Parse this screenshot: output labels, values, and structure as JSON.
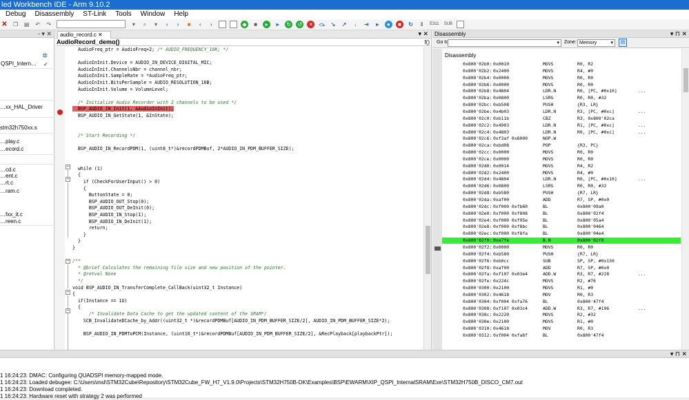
{
  "window": {
    "title": "led Workbench IDE - Arm 9.10.2"
  },
  "menu": [
    "Debug",
    "Disassembly",
    "ST-Link",
    "Tools",
    "Window",
    "Help"
  ],
  "toolbar": {
    "label_1": "E311",
    "label_2": "SUB"
  },
  "left_panel": {
    "controls": "- ▾ ✕",
    "items": [
      "QSPI_Intern…",
      "…xx_HAL_Driver",
      "stm32h750xx.s",
      "…play.c",
      "…ecord.c",
      "…cd.c",
      "…ent.c",
      "…rt.c",
      "…ram.c",
      "…fxx_it.c",
      "…reen.c"
    ]
  },
  "editor": {
    "tab_label": "audio_record.c",
    "function": "AudioRecord_demo()",
    "lines": [
      {
        "code": "  AudioFreq_ptr = AudioFreq+2; ",
        "comment": "/* AUDIO_FREQUENCY_16K; */"
      },
      {
        "code": ""
      },
      {
        "code": "  AudioInInit.Device = AUDIO_IN_DEVICE_DIGITAL_MIC;"
      },
      {
        "code": "  AudioInInit.ChannelsNbr = channel_nbr;"
      },
      {
        "code": "  AudioInInit.SampleRate = *AudioFreq_ptr;"
      },
      {
        "code": "  AudioInInit.BitsPerSample = AUDIO_RESOLUTION_16B;"
      },
      {
        "code": "  AudioInInit.Volume = VolumeLevel;"
      },
      {
        "code": ""
      },
      {
        "code": "  ",
        "comment": "/* Initialize Audio Recorder with 2 channels to be used */"
      },
      {
        "code": "",
        "highlight": "  BSP_AUDIO_IN_Init(1, &AudioInInit);"
      },
      {
        "code": "  BSP_AUDIO_IN_GetState(1, &InState);"
      },
      {
        "code": ""
      },
      {
        "code": ""
      },
      {
        "code": "  ",
        "comment": "/* Start Recording */"
      },
      {
        "code": ""
      },
      {
        "code": "  BSP_AUDIO_IN_RecordPDM(1, (uint8_t*)&recordPDMBuf, 2*AUDIO_IN_PDM_BUFFER_SIZE);"
      },
      {
        "code": ""
      },
      {
        "code": ""
      },
      {
        "code": "  while (1)"
      },
      {
        "code": "  {"
      },
      {
        "code": "    if (CheckForUserInput() > 0)"
      },
      {
        "code": "    {"
      },
      {
        "code": "      ButtonState = 0;"
      },
      {
        "code": "      BSP_AUDIO_OUT_Stop(0);"
      },
      {
        "code": "      BSP_AUDIO_OUT_DeInit(0);"
      },
      {
        "code": "      BSP_AUDIO_IN_Stop(1);"
      },
      {
        "code": "      BSP_AUDIO_IN_DeInit(1);"
      },
      {
        "code": "      return;"
      },
      {
        "code": "    }"
      },
      {
        "code": "  }"
      },
      {
        "code": "}"
      },
      {
        "code": ""
      },
      {
        "code": "",
        "comment": "/**"
      },
      {
        "code": "",
        "comment": "  * @brief Calculates the remaining file size and new position of the pointer."
      },
      {
        "code": "",
        "comment": "  * @retval None"
      },
      {
        "code": "",
        "comment": "  */"
      },
      {
        "code": "void BSP_AUDIO_IN_TransferComplete_CallBack(uint32_t Instance)"
      },
      {
        "code": "{"
      },
      {
        "code": "  if(Instance == 1U)"
      },
      {
        "code": "  {"
      },
      {
        "code": "      ",
        "comment": "/* Invalidate Data Cache to get the updated content of the SRAM*/"
      },
      {
        "code": "    SCB_InvalidateDCache_by_Addr((uint32_t *)&recordPDMBuf[AUDIO_IN_PDM_BUFFER_SIZE/2], AUDIO_IN_PDM_BUFFER_SIZE*2);"
      },
      {
        "code": ""
      },
      {
        "code": "    BSP_AUDIO_IN_PDMToPCM(Instance, (uint16_t*)&recordPDMBuf[AUDIO_IN_PDM_BUFFER_SIZE/2], &RecPlayback[playbackPtr]);"
      }
    ]
  },
  "disassembly": {
    "panel_title": "Disassembly",
    "goto_label": "Go to:",
    "zone_label": "Zone:",
    "zone_value": "Memory",
    "header": "Disassembly",
    "rows": [
      [
        "0x800'02b0:",
        "0x0010",
        "MOVS",
        "R0, R2",
        ""
      ],
      [
        "0x800'02b2:",
        "0x2400",
        "MOVS",
        "R4, #0",
        ""
      ],
      [
        "0x800'02b4:",
        "0x0000",
        "MOVS",
        "R0, R0",
        ""
      ],
      [
        "0x800'02b6:",
        "0x0000",
        "MOVS",
        "R0, R0",
        ""
      ],
      [
        "0x800'02b8:",
        "0x4804",
        "LDR.N",
        "R0, [PC, #0x10]",
        "..."
      ],
      [
        "0x800'02ba:",
        "0x0800",
        "LSRS",
        "R0, R0, #32",
        ""
      ],
      [
        "0x800'02bc:",
        "0xb508",
        "PUSH",
        "{R3, LR}",
        ""
      ],
      [
        "0x800'02be:",
        "0x4b03",
        "LDR.N",
        "R3, [PC, #0xc]",
        "..."
      ],
      [
        "0x800'02c0:",
        "0xb11b",
        "CBZ",
        "R3, 0x800'02ca",
        ""
      ],
      [
        "0x800'02c2:",
        "0x4903",
        "LDR.N",
        "R1, [PC, #0xc]",
        "..."
      ],
      [
        "0x800'02c4:",
        "0x4803",
        "LDR.N",
        "R0, [PC, #0xc]",
        "..."
      ],
      [
        "0x800'02c6:",
        "0xf3af 0x8000",
        "NOP.W",
        "",
        ""
      ],
      [
        "0x800'02ca:",
        "0xbd08",
        "POP",
        "{R3, PC}",
        ""
      ],
      [
        "0x800'02cc:",
        "0x0000",
        "MOVS",
        "R0, R0",
        ""
      ],
      [
        "0x800'02ce:",
        "0x0000",
        "MOVS",
        "R0, R0",
        ""
      ],
      [
        "0x800'02d0:",
        "0x0014",
        "MOVS",
        "R4, R2",
        ""
      ],
      [
        "0x800'02d2:",
        "0x2400",
        "MOVS",
        "R4, #0",
        ""
      ],
      [
        "0x800'02d4:",
        "0x4804",
        "LDR.N",
        "R0, [PC, #0x10]",
        "..."
      ],
      [
        "0x800'02d6:",
        "0x0800",
        "LSRS",
        "R0, R0, #32",
        ""
      ],
      [
        "0x800'02d8:",
        "0xb580",
        "PUSH",
        "{R7, LR}",
        ""
      ],
      [
        "0x800'02da:",
        "0xaf00",
        "ADD",
        "R7, SP, #0x0",
        ""
      ],
      [
        "0x800'02dc:",
        "0xf000 0xfb60",
        "BL",
        "0x800'09a0",
        ""
      ],
      [
        "0x800'02e0:",
        "0xf000 0xf808",
        "BL",
        "0x800'02f4",
        ""
      ],
      [
        "0x800'02e4:",
        "0xf000 0xf95e",
        "BL",
        "0x800'05a4",
        ""
      ],
      [
        "0x800'02e8:",
        "0xf000 0xf8bc",
        "BL",
        "0x800'0464",
        ""
      ],
      [
        "0x800'02ec:",
        "0xf000 0xf8fa",
        "BL",
        "0x800'04e4",
        ""
      ],
      [
        "0x800'02f0:",
        "0xe7fe",
        "B.N",
        "0x800'02f0",
        ""
      ],
      [
        "0x800'02f2:",
        "0x0000",
        "MOVS",
        "R0, R0",
        ""
      ],
      [
        "0x800'02f4:",
        "0xb580",
        "PUSH",
        "{R7, LR}",
        ""
      ],
      [
        "0x800'02f6:",
        "0xb0cc",
        "SUB",
        "SP, SP, #0x130",
        ""
      ],
      [
        "0x800'02f8:",
        "0xaf00",
        "ADD",
        "R7, SP, #0x0",
        ""
      ],
      [
        "0x800'02fa:",
        "0xf107 0x03e4",
        "ADD.W",
        "R3, R7, #228",
        "..."
      ],
      [
        "0x800'02fe:",
        "0x224c",
        "MOVS",
        "R2, #76",
        ""
      ],
      [
        "0x800'0300:",
        "0x2100",
        "MOVS",
        "R1, #0",
        ""
      ],
      [
        "0x800'0302:",
        "0x4618",
        "MOV",
        "R0, R3",
        ""
      ],
      [
        "0x800'0304:",
        "0xf004 0xfa76",
        "BL",
        "0x800'47f4",
        ""
      ],
      [
        "0x800'0308:",
        "0xf107 0x03c4",
        "ADD.W",
        "R3, R7, #196",
        "..."
      ],
      [
        "0x800'030c:",
        "0x2220",
        "MOVS",
        "R2, #32",
        ""
      ],
      [
        "0x800'030e:",
        "0x2100",
        "MOVS",
        "R1, #0",
        ""
      ],
      [
        "0x800'0310:",
        "0x4618",
        "MOV",
        "R0, R3",
        ""
      ],
      [
        "0x800'0312:",
        "0xf004 0xfa6f",
        "BL",
        "0x800'47f4",
        ""
      ]
    ],
    "current_index": 26
  },
  "log": {
    "lines": [
      "1 16:24:23: DMAC: Configuring QUADSPI memory-mapped mode.",
      "1 16:24:23: Loaded debugee: C:\\Users\\msl\\STM32Cube\\Repository\\STM32Cube_FW_H7_V1.9.0\\Projects\\STM32H750B-DK\\Examples\\BSP\\EWARM\\XIP_QSPI_InternalSRAM\\Exe\\STM32H750B_DISCO_CM7.out",
      "1 16:24:23: Download completed.",
      "1 16:24:23: Hardware reset with strategy 2 was performed"
    ]
  },
  "colors": {
    "titlebar": "#1a6ecf",
    "current_line": "#33ee33",
    "breakpoint_line": "#e06060",
    "comment": "#2e7a2e"
  }
}
